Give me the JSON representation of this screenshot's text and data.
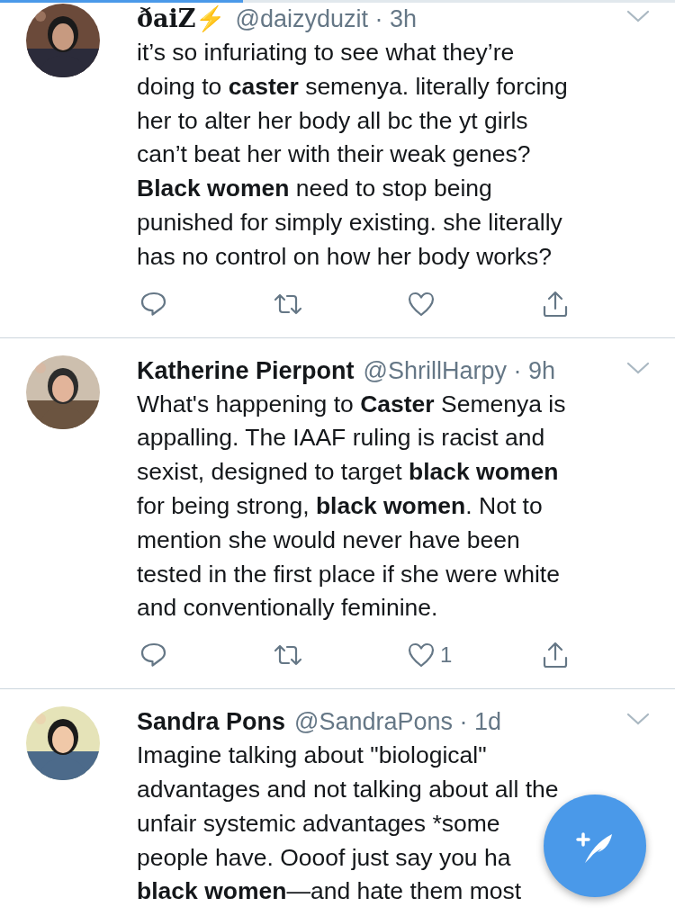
{
  "loading_bar": {
    "level": 0.36
  },
  "tweets": [
    {
      "name": "ðaiZ⚡",
      "meta": "@daizyduzit · 3h",
      "text": "it’s so infuriating to see what they’re\ndoing to **caster** semenya. literally forcing\nher to alter her body all bc the yt girls\ncan’t beat her with their weak genes?\n**Black women** need to stop being\npunished for simply existing. she literally\nhas no control on how her body works?",
      "actions": [
        {
          "kind": "reply"
        },
        {
          "kind": "retweet"
        },
        {
          "kind": "like"
        },
        {
          "kind": "share"
        }
      ]
    },
    {
      "name": "Katherine Pierpont",
      "meta": "@ShrillHarpy · 9h",
      "text": "What's happening to **Caster** Semenya is\nappalling. The IAAF ruling is racist and\nsexist, designed to target **black women**\nfor being strong, **black women**. Not to\nmention she would never have been\ntested in the first place if she were white\nand conventionally feminine.",
      "actions": [
        {
          "kind": "reply"
        },
        {
          "kind": "retweet"
        },
        {
          "kind": "like",
          "count": "1"
        },
        {
          "kind": "share"
        }
      ]
    },
    {
      "name": "Sandra Pons",
      "meta": "@SandraPons · 1d",
      "text": "Imagine talking about \"biological\"\nadvantages and not talking about all the\nunfair systemic advantages *some\npeople have. Oooof just say you ha\n**black women**—and hate them most"
    }
  ]
}
